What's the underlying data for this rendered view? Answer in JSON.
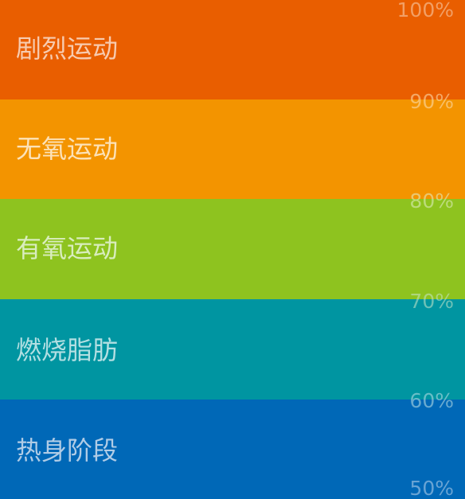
{
  "zones": [
    {
      "label": "剧烈运动",
      "color": "#E95E00",
      "text_color": "#F7CBB0"
    },
    {
      "label": "无氧运动",
      "color": "#F39400",
      "text_color": "#FCE2B8"
    },
    {
      "label": "有氧运动",
      "color": "#8EC31F",
      "text_color": "#D9EDBE"
    },
    {
      "label": "燃烧脂肪",
      "color": "#0095A1",
      "text_color": "#B3DFE2"
    },
    {
      "label": "热身阶段",
      "color": "#0068B7",
      "text_color": "#B0CCE6"
    }
  ],
  "thresholds": [
    "100%",
    "90%",
    "80%",
    "70%",
    "60%",
    "50%"
  ]
}
